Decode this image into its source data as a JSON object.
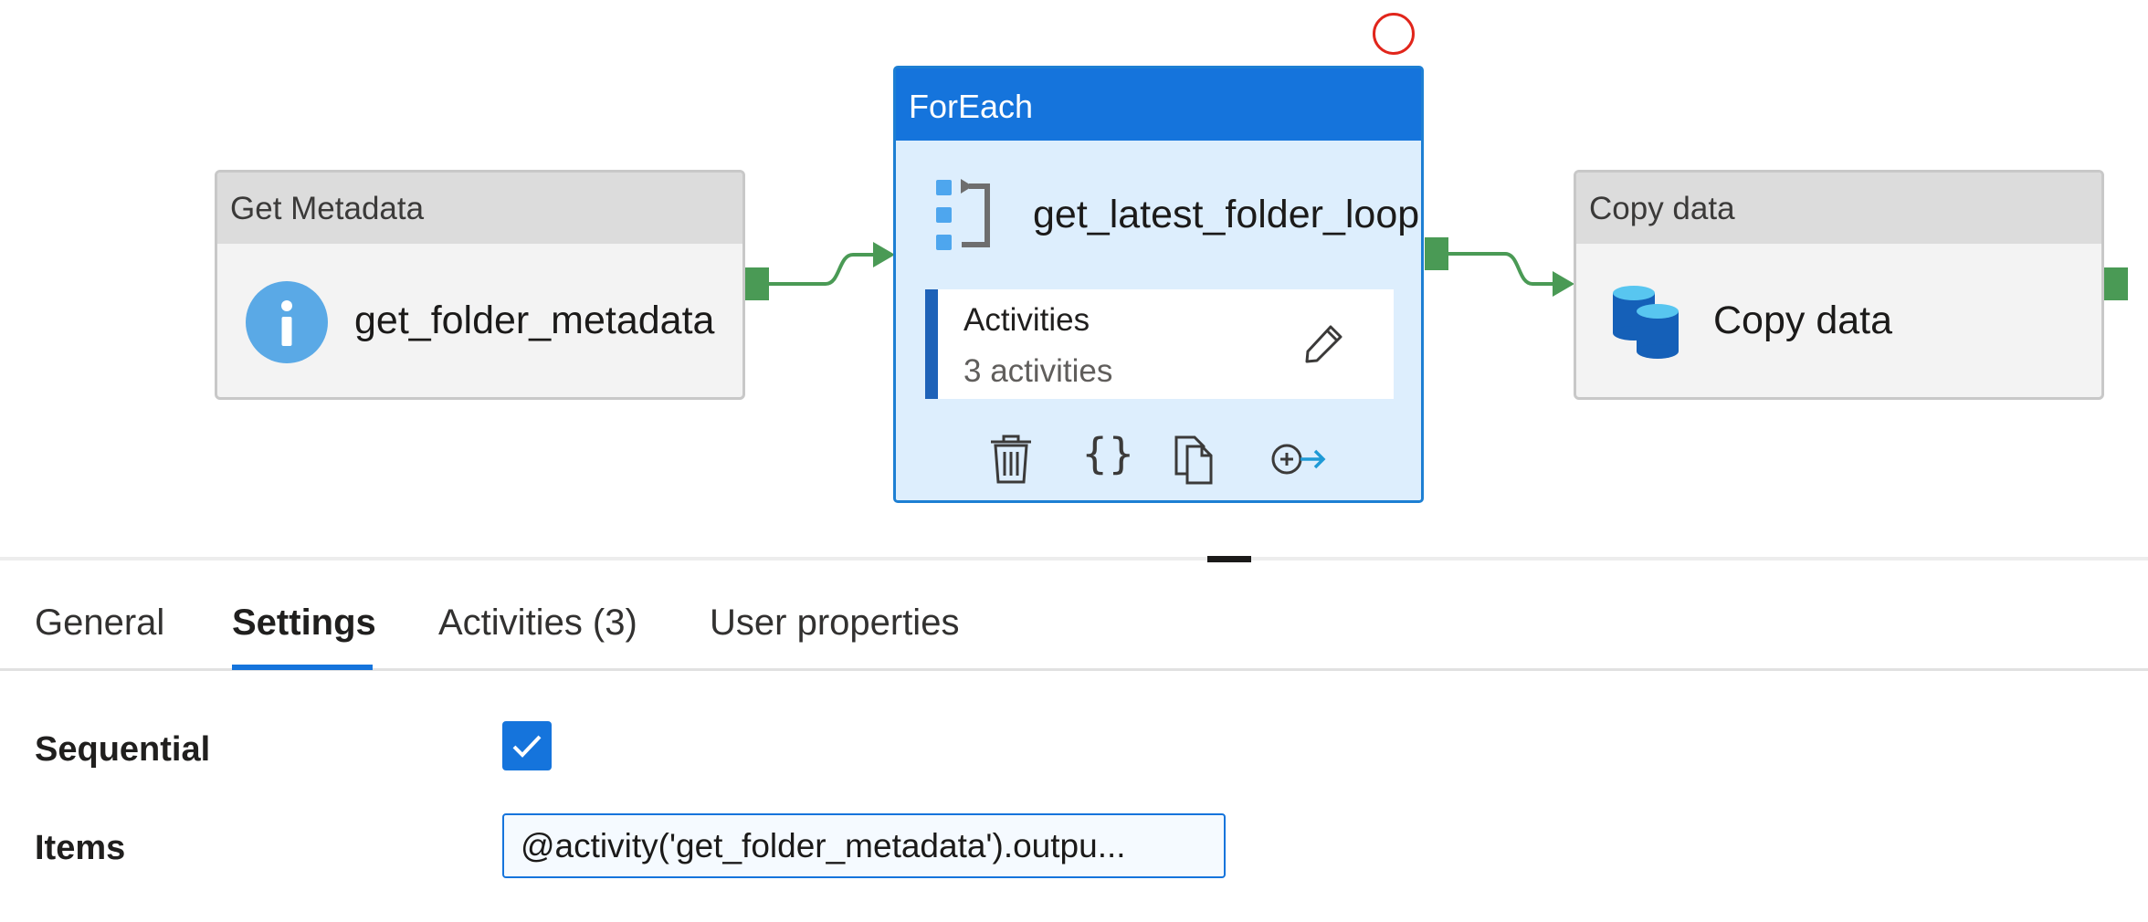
{
  "pipeline": {
    "get_metadata": {
      "type_label": "Get Metadata",
      "name": "get_folder_metadata",
      "icon": "info-icon"
    },
    "foreach": {
      "type_label": "ForEach",
      "name": "get_latest_folder_loop",
      "icon": "foreach-loop-icon",
      "activities_label": "Activities",
      "activities_count": "3 activities",
      "toolbar": [
        "delete-icon",
        "code-braces-icon",
        "copy-icon",
        "add-output-icon"
      ]
    },
    "copy_data": {
      "type_label": "Copy data",
      "name": "Copy data",
      "icon": "database-icon"
    }
  },
  "tabs": [
    {
      "label": "General",
      "active": false
    },
    {
      "label": "Settings",
      "active": true
    },
    {
      "label": "Activities (3)",
      "active": false
    },
    {
      "label": "User properties",
      "active": false
    }
  ],
  "settings": {
    "sequential": {
      "label": "Sequential",
      "checked": true
    },
    "items": {
      "label": "Items",
      "value": "@activity('get_folder_metadata').outpu..."
    }
  },
  "colors": {
    "accent": "#1574dc",
    "success_port": "#4a9a55",
    "selection_ring": "#e1251b"
  }
}
